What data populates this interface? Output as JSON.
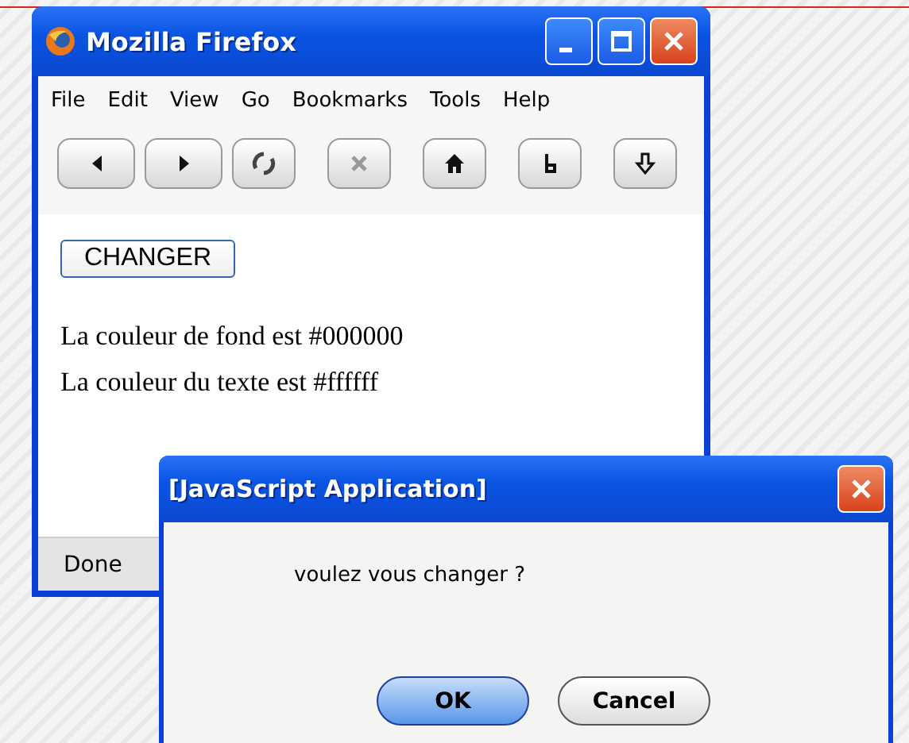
{
  "browser_window": {
    "title": "Mozilla Firefox",
    "menu": [
      "File",
      "Edit",
      "View",
      "Go",
      "Bookmarks",
      "Tools",
      "Help"
    ],
    "toolbar": [
      {
        "kind": "back"
      },
      {
        "kind": "forward"
      },
      {
        "kind": "reload"
      },
      {
        "kind": "stop",
        "disabled": true
      },
      {
        "kind": "home"
      },
      {
        "kind": "bookmark"
      },
      {
        "kind": "download"
      }
    ],
    "page": {
      "button": "CHANGER",
      "lines": [
        "La couleur de fond est #000000",
        "La couleur du texte est #ffffff"
      ]
    },
    "status_bar": "Done"
  },
  "dialog": {
    "title": "[JavaScript Application]",
    "message": "voulez vous changer ?",
    "buttons": [
      {
        "label": "OK",
        "default": true
      },
      {
        "label": "Cancel",
        "default": false
      }
    ]
  }
}
